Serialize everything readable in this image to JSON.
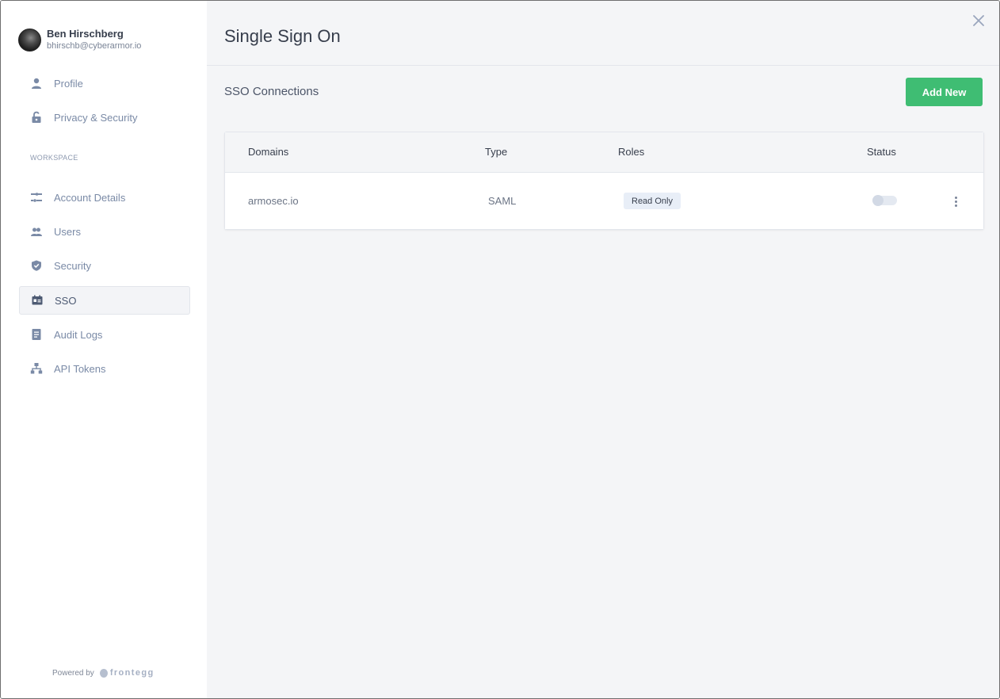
{
  "user": {
    "name": "Ben Hirschberg",
    "email": "bhirschb@cyberarmor.io"
  },
  "sidebar": {
    "personal_items": [
      {
        "label": "Profile",
        "icon": "user-icon"
      },
      {
        "label": "Privacy & Security",
        "icon": "lock-icon"
      }
    ],
    "workspace_label": "WORKSPACE",
    "workspace_items": [
      {
        "label": "Account Details",
        "icon": "sliders-icon"
      },
      {
        "label": "Users",
        "icon": "users-icon"
      },
      {
        "label": "Security",
        "icon": "shield-icon"
      },
      {
        "label": "SSO",
        "icon": "id-card-icon",
        "active": true
      },
      {
        "label": "Audit Logs",
        "icon": "document-icon"
      },
      {
        "label": "API Tokens",
        "icon": "hierarchy-icon"
      }
    ],
    "powered_by": "Powered by",
    "brand": "frontegg"
  },
  "main": {
    "title": "Single Sign On",
    "section_title": "SSO Connections",
    "add_button": "Add New",
    "table": {
      "columns": [
        "Domains",
        "Type",
        "Roles",
        "Status"
      ],
      "rows": [
        {
          "domain": "armosec.io",
          "type": "SAML",
          "role": "Read Only",
          "status_enabled": false
        }
      ]
    }
  },
  "colors": {
    "accent_green": "#3fbd73",
    "sidebar_icon": "#7a8aa6",
    "main_bg": "#f4f5f7"
  }
}
